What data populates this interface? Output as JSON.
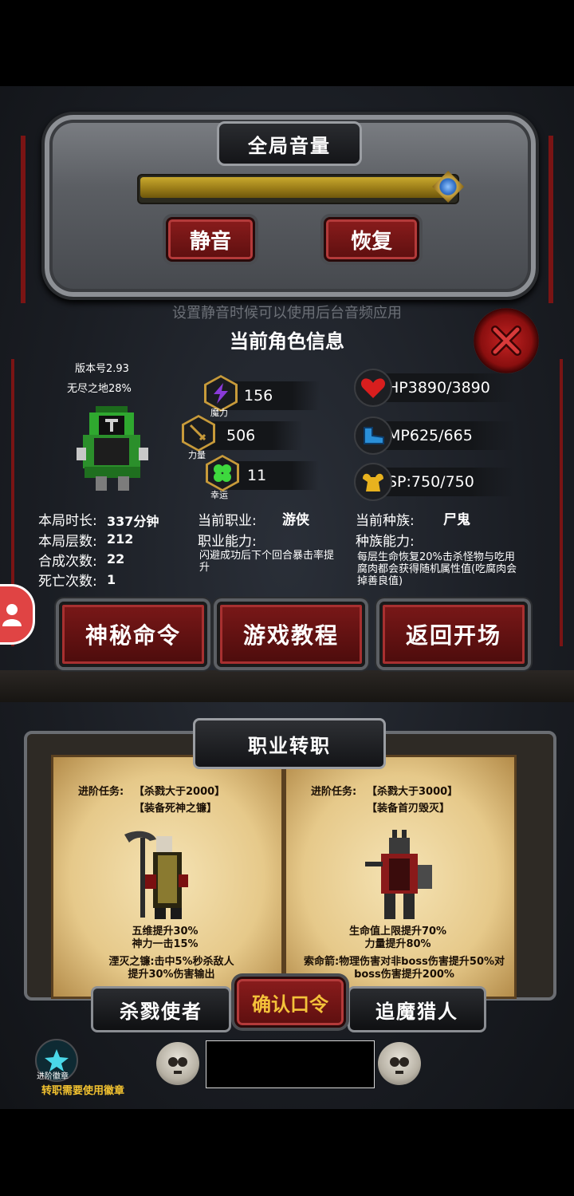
{
  "volume": {
    "title": "全局音量",
    "level": 0.98,
    "mute_label": "静音",
    "restore_label": "恢复",
    "hint": "设置静音时候可以使用后台音频应用"
  },
  "character": {
    "section_title": "当前角色信息",
    "version": "版本号2.93",
    "mode": "无尽之地28%",
    "magic": {
      "value": "156",
      "label": "魔力"
    },
    "strength": {
      "value": "506",
      "label": "力量"
    },
    "luck": {
      "value": "11",
      "label": "幸运"
    },
    "hp": "HP3890/3890",
    "mp": "MP625/665",
    "sp": "SP:750/750",
    "stats": [
      {
        "label": "本局时长:",
        "value": "337分钟"
      },
      {
        "label": "本局层数:",
        "value": "212"
      },
      {
        "label": "合成次数:",
        "value": "22"
      },
      {
        "label": "死亡次数:",
        "value": "1"
      }
    ],
    "job_label": "当前职业:",
    "job_value": "游侠",
    "job_ability_label": "职业能力:",
    "job_ability": "闪避成功后下个回合暴击率提升",
    "race_label": "当前种族:",
    "race_value": "尸鬼",
    "race_ability_label": "种族能力:",
    "race_ability": "每层生命恢复20%击杀怪物与吃用腐肉都会获得随机属性值(吃腐肉会掉善良值)"
  },
  "actions": {
    "secret_command": "神秘命令",
    "tutorial": "游戏教程",
    "back_to_start": "返回开场"
  },
  "job_change": {
    "title": "职业转职",
    "left": {
      "task_prefix": "进阶任务:",
      "task1": "【杀戮大于2000】",
      "task2": "【装备死神之镰】",
      "bonus1": "五维提升30%",
      "bonus2": "神力一击15%",
      "skill": "湮灭之镰:击中5%秒杀敌人提升30%伤害输出",
      "name": "杀戮使者"
    },
    "right": {
      "task_prefix": "进阶任务:",
      "task1": "【杀戮大于3000】",
      "task2": "【装备首刃毁灭】",
      "bonus1": "生命值上限提升70%",
      "bonus2": "力量提升80%",
      "skill": "索命箭:物理伤害对非boss伤害提升50%对boss伤害提升200%",
      "name": "追魔猎人"
    },
    "confirm_label": "确认口令",
    "badge_label": "进阶徽章",
    "badge_note": "转职需要使用徽章"
  },
  "colors": {
    "gold": "#c9a92e",
    "red": "#8a1c1c",
    "badge_text": "#f2c230"
  }
}
